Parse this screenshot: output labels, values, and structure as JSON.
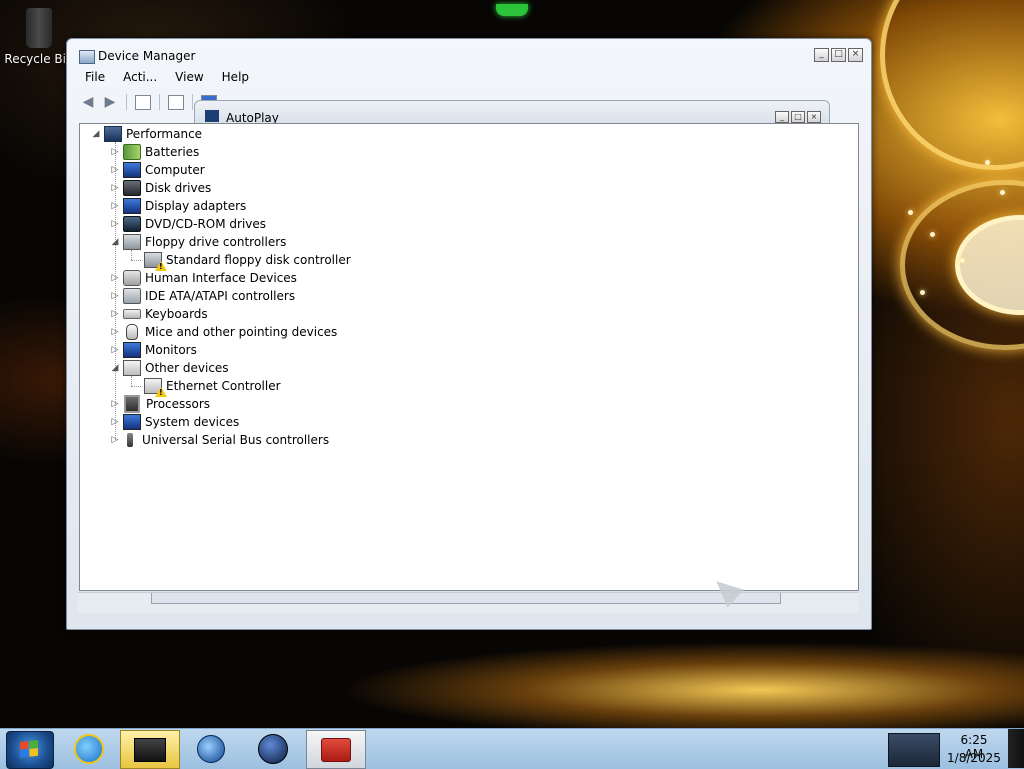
{
  "desktop": {
    "icons": [
      {
        "label": "Recycle Bin"
      }
    ]
  },
  "window": {
    "title": "Device Manager",
    "controls": {
      "minimize": "_",
      "maximize": "□",
      "close": "×"
    },
    "menu": [
      "File",
      "Acti...",
      "View",
      "Help"
    ]
  },
  "autoplay": {
    "title": "AutoPlay"
  },
  "tree": {
    "root": "Performance",
    "categories": [
      {
        "label": "Batteries",
        "icon": "battery-icon",
        "expanded": false
      },
      {
        "label": "Computer",
        "icon": "computer-icon",
        "expanded": false
      },
      {
        "label": "Disk drives",
        "icon": "disk-drive-icon",
        "expanded": false
      },
      {
        "label": "Display adapters",
        "icon": "display-adapter-icon",
        "expanded": false
      },
      {
        "label": "DVD/CD-ROM drives",
        "icon": "dvd-drive-icon",
        "expanded": false
      },
      {
        "label": "Floppy drive controllers",
        "icon": "floppy-controller-icon",
        "expanded": true,
        "children": [
          {
            "label": "Standard floppy disk controller",
            "warning": true
          }
        ]
      },
      {
        "label": "Human Interface Devices",
        "icon": "hid-icon",
        "expanded": false
      },
      {
        "label": "IDE ATA/ATAPI controllers",
        "icon": "ide-controller-icon",
        "expanded": false
      },
      {
        "label": "Keyboards",
        "icon": "keyboard-icon",
        "expanded": false
      },
      {
        "label": "Mice and other pointing devices",
        "icon": "mouse-icon",
        "expanded": false
      },
      {
        "label": "Monitors",
        "icon": "monitor-icon",
        "expanded": false
      },
      {
        "label": "Other devices",
        "icon": "other-devices-icon",
        "expanded": true,
        "children": [
          {
            "label": "Ethernet Controller",
            "warning": true
          }
        ]
      },
      {
        "label": "Processors",
        "icon": "processor-icon",
        "expanded": false
      },
      {
        "label": "System devices",
        "icon": "system-devices-icon",
        "expanded": false
      },
      {
        "label": "Universal Serial Bus controllers",
        "icon": "usb-controller-icon",
        "expanded": false
      }
    ]
  },
  "taskbar": {
    "apps": [
      {
        "name": "internet-explorer",
        "icon": "ie-icon"
      },
      {
        "name": "device-manager",
        "icon": "device-manager-icon",
        "active": true
      },
      {
        "name": "media-player",
        "icon": "media-player-icon"
      },
      {
        "name": "globe-app",
        "icon": "globe-icon"
      },
      {
        "name": "toolbox-app",
        "icon": "toolbox-icon",
        "active": true
      }
    ],
    "clock": {
      "time": "6:25 AM",
      "date": "1/8/2025"
    }
  },
  "colors": {
    "taskbar": "#bfd8ee",
    "window_frame": "#dfe6ee",
    "warning": "#f2c811",
    "wallpaper_glow": "#ffc83c"
  }
}
